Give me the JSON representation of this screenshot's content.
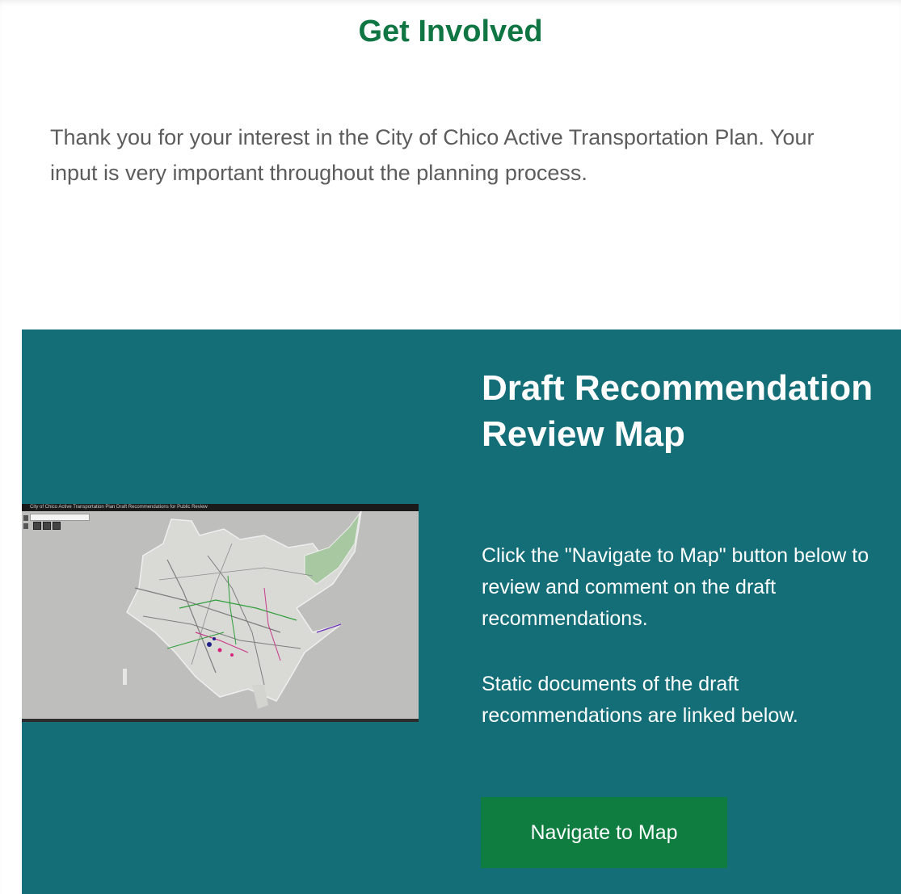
{
  "header": {
    "title": "Get Involved"
  },
  "intro": {
    "text": "Thank you for your interest in the City of Chico Active Transportation Plan. Your input is very important throughout the planning process."
  },
  "map_section": {
    "heading": "Draft Recommendation Review Map",
    "description_1": "Click the \"Navigate to Map\" button below to review and comment on the draft recommendations.",
    "description_2": "Static documents of the draft recommendations  are linked below.",
    "button_label": "Navigate to Map",
    "thumbnail_title": "City of Chico Active Transportation Plan Draft Recommendations for Public Review"
  },
  "colors": {
    "title_green": "#0f7543",
    "panel_teal": "#146e78",
    "button_green": "#0f7d40",
    "intro_text": "#5c5c5c"
  },
  "icons": {
    "map_tools": [
      "home-icon",
      "layers-icon",
      "legend-icon"
    ]
  }
}
